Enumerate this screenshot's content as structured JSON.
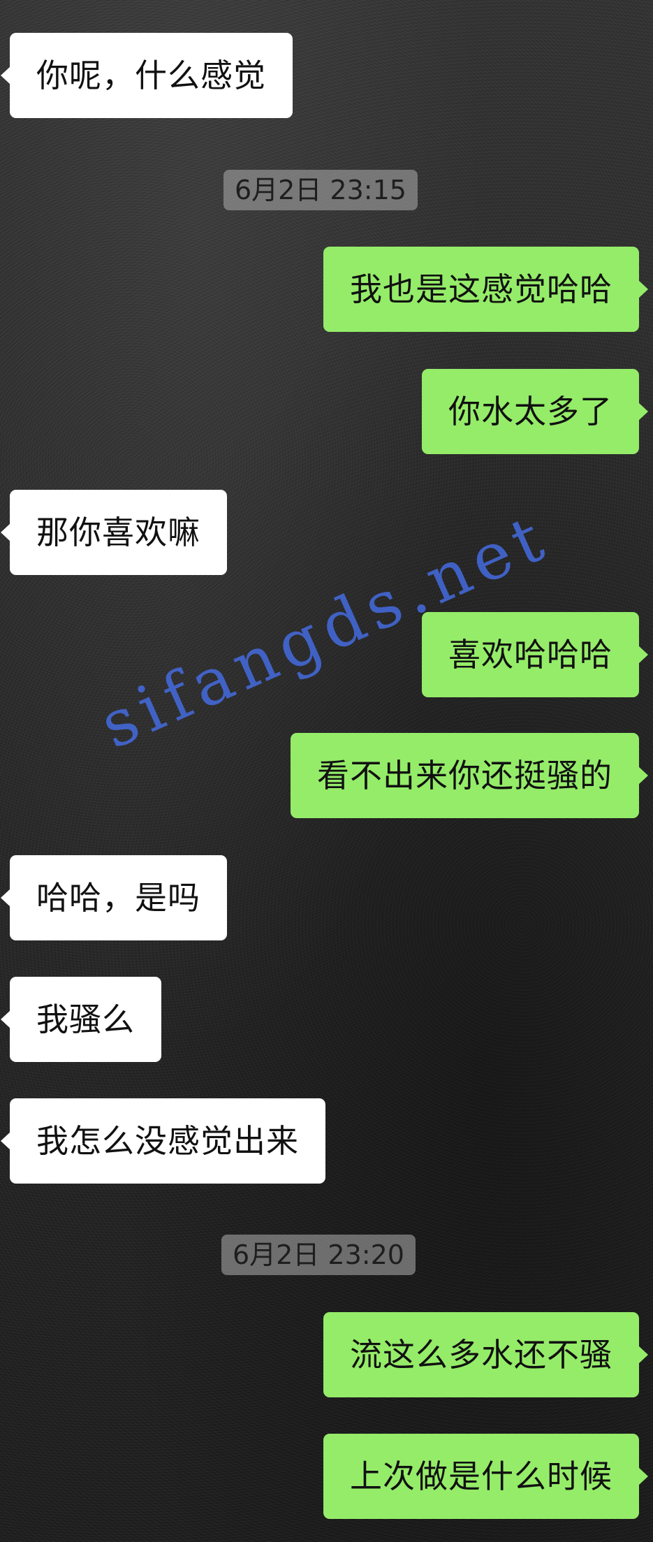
{
  "messages": [
    {
      "dir": "in",
      "text": "你呢，什么感觉"
    },
    {
      "dir": "time",
      "text": "6月2日 23:15"
    },
    {
      "dir": "out",
      "text": "我也是这感觉哈哈"
    },
    {
      "dir": "out",
      "text": "你水太多了"
    },
    {
      "dir": "in",
      "text": "那你喜欢嘛"
    },
    {
      "dir": "out",
      "text": "喜欢哈哈哈"
    },
    {
      "dir": "out",
      "text": "看不出来你还挺骚的"
    },
    {
      "dir": "in",
      "text": "哈哈，是吗"
    },
    {
      "dir": "in",
      "text": "我骚么"
    },
    {
      "dir": "in",
      "text": "我怎么没感觉出来"
    },
    {
      "dir": "time",
      "text": "6月2日 23:20"
    },
    {
      "dir": "out",
      "text": "流这么多水还不骚"
    },
    {
      "dir": "out",
      "text": "上次做是什么时候"
    }
  ],
  "watermark": "sifangds.net",
  "colors": {
    "incoming_bubble": "#ffffff",
    "outgoing_bubble": "#95ec69",
    "timestamp_bg": "#a0a0a0",
    "watermark": "#466ee6"
  }
}
